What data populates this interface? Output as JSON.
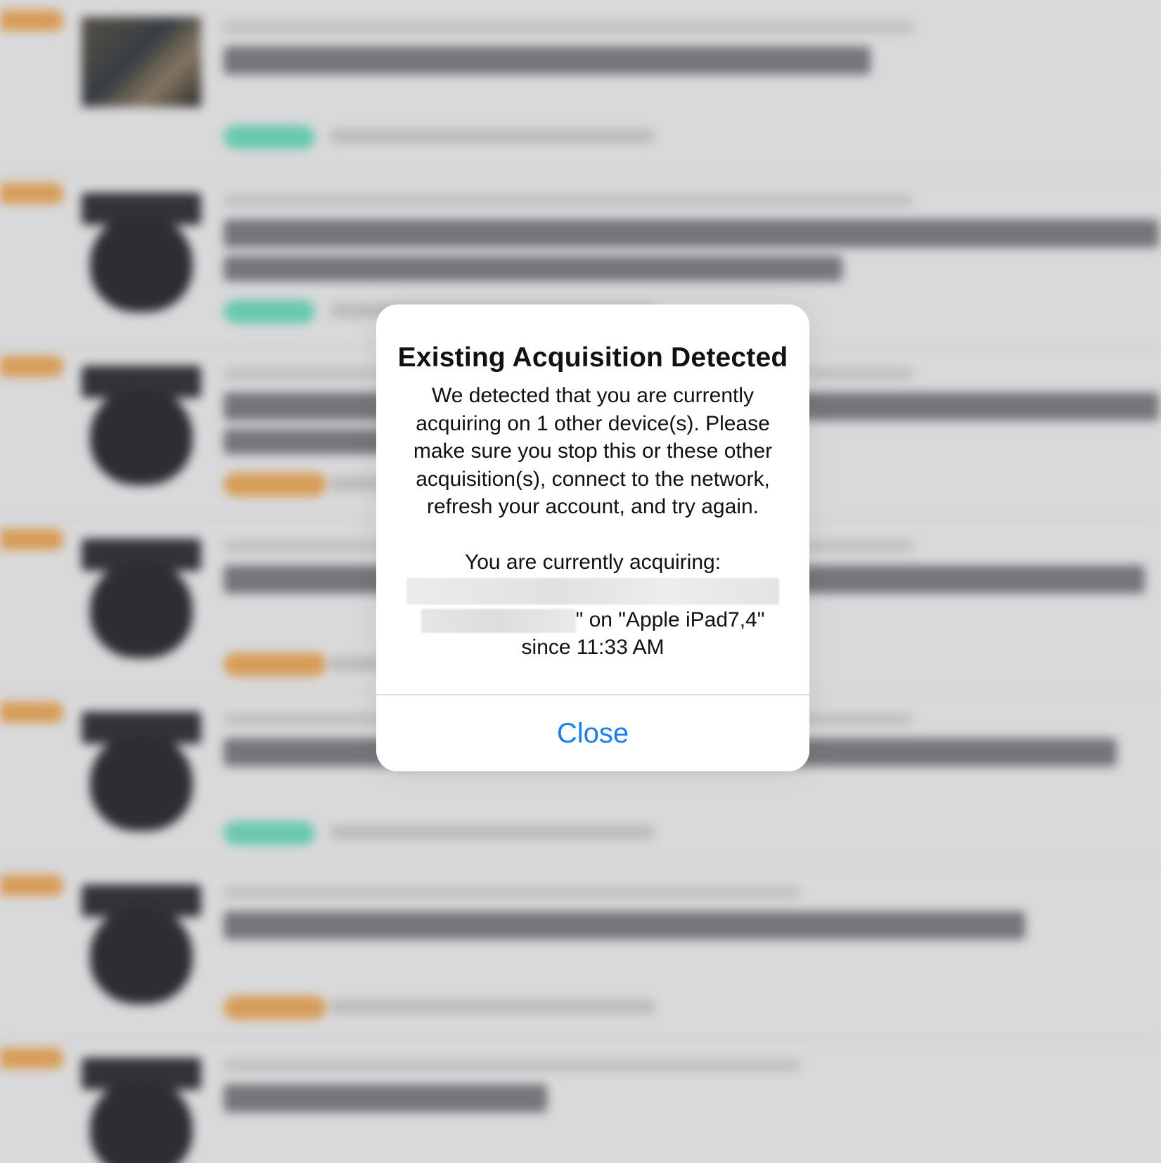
{
  "alert": {
    "title": "Existing Acquisition Detected",
    "message": "We detected that you are currently acquiring on 1 other device(s). Please make sure you stop this or these other acquisition(s), connect to the network, refresh your account, and try again.",
    "detail_heading": "You are currently acquiring:",
    "detail_device": "\" on \"Apple iPad7,4\"",
    "detail_since": "since 11:33 AM",
    "close_label": "Close"
  },
  "colors": {
    "accent": "#1a7ff0",
    "flag_orange": "#e0a35c",
    "tag_green": "#6fd1b5",
    "background": "#e2e2e4"
  },
  "background_rows": [
    {
      "thumb": "photo",
      "tag": "green"
    },
    {
      "thumb": "part",
      "tag": "green"
    },
    {
      "thumb": "part",
      "tag": "orange"
    },
    {
      "thumb": "part",
      "tag": "orange"
    },
    {
      "thumb": "part",
      "tag": "green"
    },
    {
      "thumb": "part",
      "tag": "orange"
    },
    {
      "thumb": "part",
      "tag": "none"
    }
  ]
}
